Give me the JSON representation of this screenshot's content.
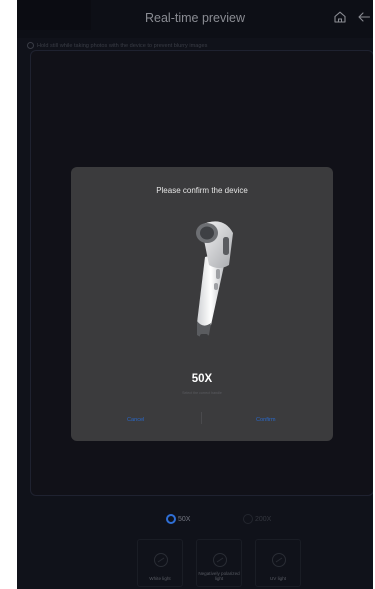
{
  "header": {
    "title": "Real-time preview"
  },
  "hint": "Hold still while taking photos with the device to prevent blurry images",
  "modal": {
    "title": "Please confirm the device",
    "model": "50X",
    "subtitle": "Select the correct handle",
    "cancel_label": "Cancel",
    "confirm_label": "Confirm"
  },
  "magnification": {
    "options": [
      {
        "label": "50X",
        "selected": true
      },
      {
        "label": "200X",
        "selected": false
      }
    ]
  },
  "light_modes": [
    {
      "label": "White light",
      "icon": "white-light-icon"
    },
    {
      "label": "Negatively polarized light",
      "icon": "polarized-light-icon"
    },
    {
      "label": "UV light",
      "icon": "uv-light-icon"
    }
  ],
  "colors": {
    "accent": "#2f6fd6",
    "button_text": "#2a68c9",
    "modal_bg": "#3b3b3d",
    "app_bg": "#10121a"
  }
}
